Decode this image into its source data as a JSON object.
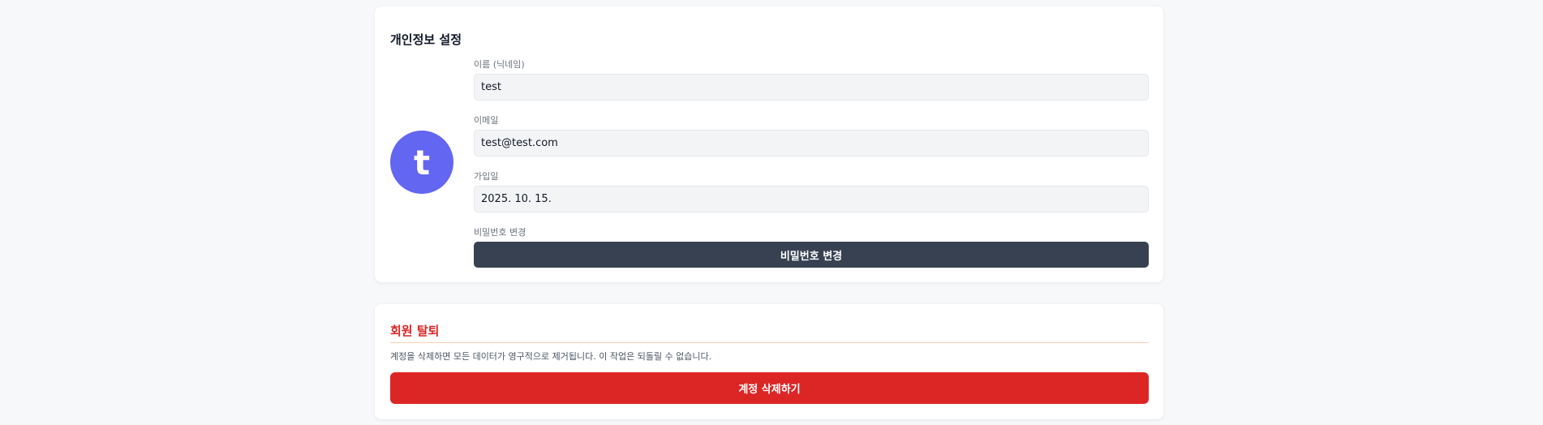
{
  "profile": {
    "title": "개인정보 설정",
    "avatar_initial": "t",
    "avatar_color": "#6366f1",
    "name_label": "이름 (닉네임)",
    "name_value": "test",
    "email_label": "이메일",
    "email_value": "test@test.com",
    "joined_label": "가입일",
    "joined_value": "2025. 10. 15.",
    "password_label": "비밀번호 변경",
    "password_button": "비밀번호 변경"
  },
  "delete_account": {
    "title": "회원 탈퇴",
    "description": "계정을 삭제하면 모든 데이터가 영구적으로 제거됩니다. 이 작업은 되돌릴 수 없습니다.",
    "button": "계정 삭제하기",
    "accent_color": "#dc2626"
  }
}
